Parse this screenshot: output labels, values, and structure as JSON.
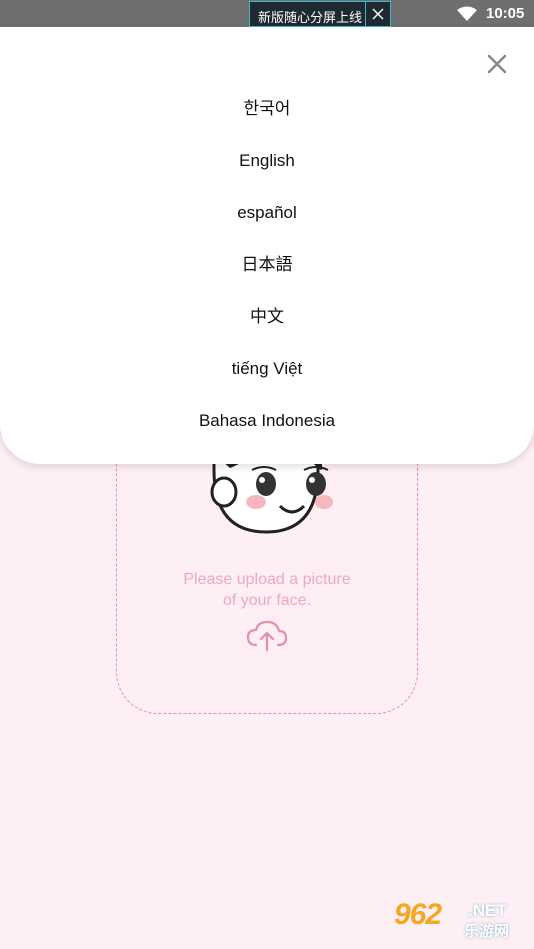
{
  "status_bar": {
    "notification_text": "新版随心分屏上线",
    "time": "10:05",
    "icons": [
      "wifi-icon",
      "close-icon"
    ]
  },
  "language_sheet": {
    "close_icon": "close-icon",
    "languages": [
      {
        "label": "한국어"
      },
      {
        "label": "English"
      },
      {
        "label": "español"
      },
      {
        "label": "日本語"
      },
      {
        "label": "中文"
      },
      {
        "label": "tiếng Việt"
      },
      {
        "label": "Bahasa Indonesia"
      }
    ]
  },
  "upload_card": {
    "line1": "Please upload a picture",
    "line2": "of your face.",
    "icon": "cloud-upload-icon",
    "accent_color": "#e58fa8",
    "text_color": "#f0a8bc"
  },
  "background_color": "#fdeff3",
  "watermark": {
    "logo": "962",
    "net": ".NET",
    "cn": "乐游网"
  }
}
